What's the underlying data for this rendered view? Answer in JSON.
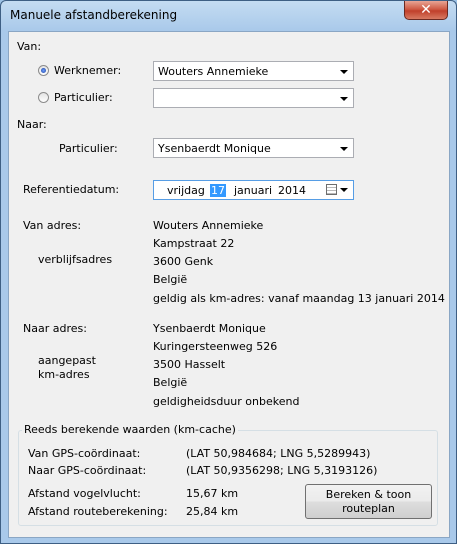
{
  "window": {
    "title": "Manuele afstandberekening",
    "close_label": "✕"
  },
  "van": {
    "section_label": "Van:",
    "werknemer_label": "Werknemer:",
    "werknemer_value": "Wouters Annemieke",
    "werknemer_selected": true,
    "particulier_label": "Particulier:",
    "particulier_value": ""
  },
  "naar": {
    "section_label": "Naar:",
    "particulier_label": "Particulier:",
    "particulier_value": "Ysenbaerdt Monique"
  },
  "referentiedatum": {
    "label": "Referentiedatum:",
    "weekday": "vrijdag",
    "day": "17",
    "month": "januari",
    "year": "2014"
  },
  "van_adres": {
    "label": "Van adres:",
    "sublabel": "verblijfsadres",
    "name": "Wouters Annemieke",
    "street": "Kampstraat 22",
    "city": "3600 Genk",
    "country": "België",
    "validity": "geldig als km-adres: vanaf maandag 13 januari 2014"
  },
  "naar_adres": {
    "label": "Naar adres:",
    "sublabel_line1": "aangepast",
    "sublabel_line2": "km-adres",
    "name": "Ysenbaerdt Monique",
    "street": "Kuringersteenweg 526",
    "city": "3500 Hasselt",
    "country": "België",
    "validity": "geldigheidsduur onbekend"
  },
  "cache": {
    "title": "Reeds berekende waarden  (km-cache)",
    "van_gps_label": "Van GPS-coördinaat:",
    "van_gps_value": "(LAT 50,984684; LNG 5,5289943)",
    "naar_gps_label": "Naar GPS-coördinaat:",
    "naar_gps_value": "(LAT 50,9356298; LNG 5,3193126)",
    "vogelvlucht_label": "Afstand vogelvlucht:",
    "vogelvlucht_value": "15,67 km",
    "route_label": "Afstand routeberekening:",
    "route_value": "25,84 km",
    "button_line1": "Bereken & toon",
    "button_line2": "routeplan"
  }
}
